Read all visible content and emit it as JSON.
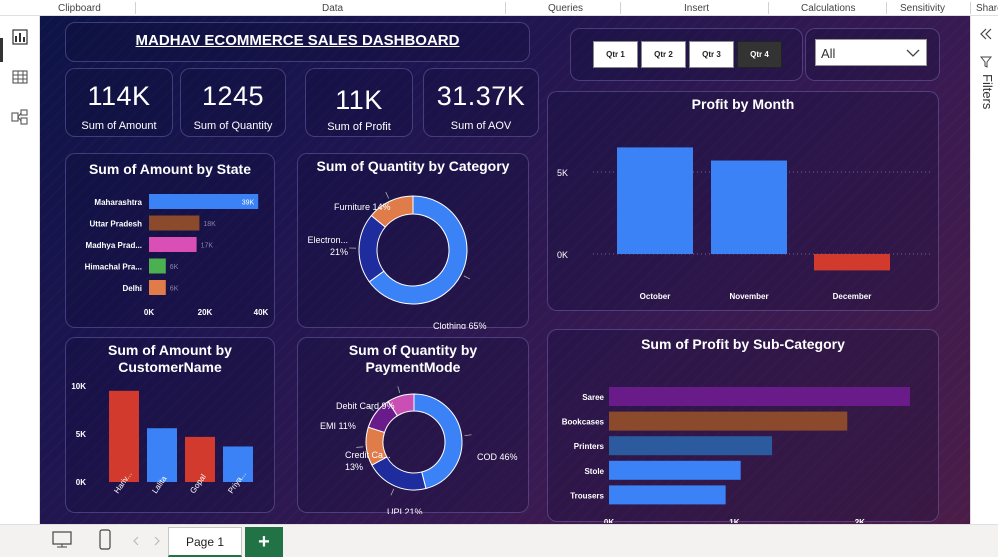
{
  "ribbon": {
    "groups": [
      "Clipboard",
      "Data",
      "Queries",
      "Insert",
      "Calculations",
      "Sensitivity",
      "Share"
    ]
  },
  "dashboard": {
    "title": "MADHAV ECOMMERCE SALES DASHBOARD",
    "quarters": [
      "Qtr 1",
      "Qtr 2",
      "Qtr 3",
      "Qtr 4"
    ],
    "selected_quarter": "Qtr 4",
    "dropdown_value": "All"
  },
  "kpis": [
    {
      "value": "114K",
      "label": "Sum of Amount"
    },
    {
      "value": "1245",
      "label": "Sum of Quantity"
    },
    {
      "value": "11K",
      "label": "Sum of Profit"
    },
    {
      "value": "31.37K",
      "label": "Sum of AOV"
    }
  ],
  "filters_label": "Filters",
  "page_tab": "Page 1",
  "add_page_label": "+",
  "colors": {
    "blue": "#3b82f6",
    "brown": "#8b4a2b",
    "pink": "#d94fb5",
    "green": "#4caf50",
    "orange": "#e07b4a",
    "red": "#d23a2e",
    "navy": "#1e2c9e",
    "purple": "#6a1b8a",
    "teal_blue": "#2b5a9e",
    "magenta": "#c94fb5"
  },
  "chart_data": [
    {
      "type": "bar",
      "orientation": "horizontal",
      "title": "Sum of Amount by State",
      "categories": [
        "Maharashtra",
        "Uttar Pradesh",
        "Madhya Prad...",
        "Himachal Pra...",
        "Delhi"
      ],
      "values": [
        39000,
        18000,
        17000,
        6000,
        6000
      ],
      "data_labels": [
        "39K",
        "18K",
        "17K",
        "6K",
        "6K"
      ],
      "bar_colors": [
        "#3b82f6",
        "#8b4a2b",
        "#d94fb5",
        "#4caf50",
        "#e07b4a"
      ],
      "xlim": [
        0,
        40000
      ],
      "xticks": [
        "0K",
        "20K",
        "40K"
      ]
    },
    {
      "type": "pie",
      "donut": true,
      "title": "Sum of Quantity by Category",
      "categories": [
        "Clothing",
        "Electron...",
        "Furniture"
      ],
      "values": [
        65,
        21,
        14
      ],
      "labels": [
        "Clothing 65%",
        "Electron...\n21%",
        "Furniture 14%"
      ],
      "colors": [
        "#3b82f6",
        "#1e2c9e",
        "#e07b4a"
      ]
    },
    {
      "type": "bar",
      "title": "Profit by Month",
      "categories": [
        "October",
        "November",
        "December"
      ],
      "values": [
        6500,
        5700,
        -1000
      ],
      "bar_colors": [
        "#3b82f6",
        "#3b82f6",
        "#d23a2e"
      ],
      "ylim": [
        -2000,
        7000
      ],
      "yticks": [
        "5K",
        "0K"
      ],
      "grid": true
    },
    {
      "type": "bar",
      "title": "Sum of Amount by CustomerName",
      "categories": [
        "Hariv...",
        "Lalita",
        "Gopal",
        "Priya..."
      ],
      "values": [
        9500,
        5600,
        4700,
        3700
      ],
      "bar_colors": [
        "#d23a2e",
        "#3b82f6",
        "#d23a2e",
        "#3b82f6"
      ],
      "ylim": [
        0,
        10000
      ],
      "yticks": [
        "10K",
        "5K",
        "0K"
      ]
    },
    {
      "type": "pie",
      "donut": true,
      "title": "Sum of Quantity by PaymentMode",
      "categories": [
        "COD",
        "UPI",
        "Credit Ca...",
        "EMI",
        "Debit Card"
      ],
      "values": [
        46,
        21,
        13,
        11,
        9
      ],
      "labels": [
        "COD 46%",
        "UPI 21%",
        "Credit Ca...\n13%",
        "EMI 11%",
        "Debit Card 9%"
      ],
      "colors": [
        "#3b82f6",
        "#1e2c9e",
        "#e07b4a",
        "#6a1b8a",
        "#c94fb5"
      ]
    },
    {
      "type": "bar",
      "orientation": "horizontal",
      "title": "Sum of Profit by Sub-Category",
      "categories": [
        "Saree",
        "Bookcases",
        "Printers",
        "Stole",
        "Trousers"
      ],
      "values": [
        2400,
        1900,
        1300,
        1050,
        930
      ],
      "bar_colors": [
        "#6a1b8a",
        "#8b4a2b",
        "#2b5a9e",
        "#3b82f6",
        "#3b82f6"
      ],
      "xlim": [
        0,
        2400
      ],
      "xticks": [
        "0K",
        "1K",
        "2K"
      ]
    }
  ]
}
